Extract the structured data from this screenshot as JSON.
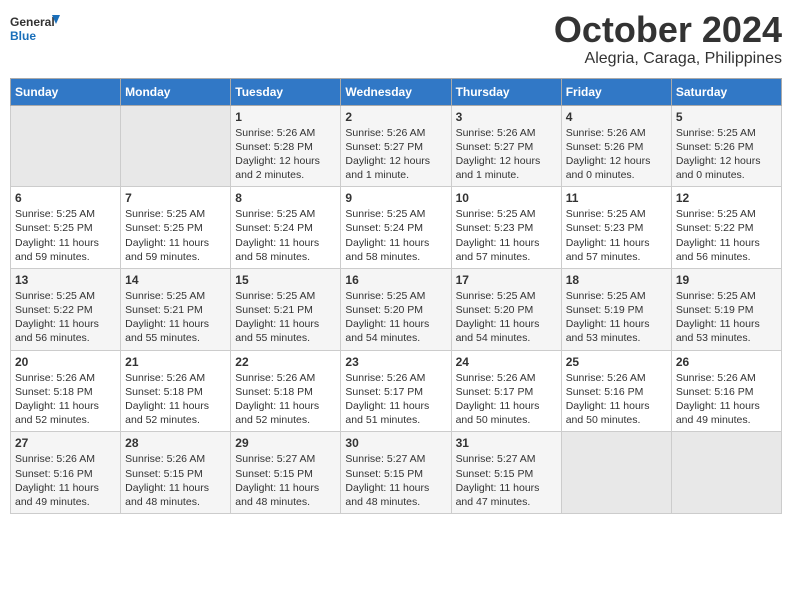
{
  "logo": {
    "text_general": "General",
    "text_blue": "Blue"
  },
  "title": "October 2024",
  "subtitle": "Alegria, Caraga, Philippines",
  "days_of_week": [
    "Sunday",
    "Monday",
    "Tuesday",
    "Wednesday",
    "Thursday",
    "Friday",
    "Saturday"
  ],
  "weeks": [
    [
      {
        "day": "",
        "content": ""
      },
      {
        "day": "",
        "content": ""
      },
      {
        "day": "1",
        "content": "Sunrise: 5:26 AM\nSunset: 5:28 PM\nDaylight: 12 hours\nand 2 minutes."
      },
      {
        "day": "2",
        "content": "Sunrise: 5:26 AM\nSunset: 5:27 PM\nDaylight: 12 hours\nand 1 minute."
      },
      {
        "day": "3",
        "content": "Sunrise: 5:26 AM\nSunset: 5:27 PM\nDaylight: 12 hours\nand 1 minute."
      },
      {
        "day": "4",
        "content": "Sunrise: 5:26 AM\nSunset: 5:26 PM\nDaylight: 12 hours\nand 0 minutes."
      },
      {
        "day": "5",
        "content": "Sunrise: 5:25 AM\nSunset: 5:26 PM\nDaylight: 12 hours\nand 0 minutes."
      }
    ],
    [
      {
        "day": "6",
        "content": "Sunrise: 5:25 AM\nSunset: 5:25 PM\nDaylight: 11 hours\nand 59 minutes."
      },
      {
        "day": "7",
        "content": "Sunrise: 5:25 AM\nSunset: 5:25 PM\nDaylight: 11 hours\nand 59 minutes."
      },
      {
        "day": "8",
        "content": "Sunrise: 5:25 AM\nSunset: 5:24 PM\nDaylight: 11 hours\nand 58 minutes."
      },
      {
        "day": "9",
        "content": "Sunrise: 5:25 AM\nSunset: 5:24 PM\nDaylight: 11 hours\nand 58 minutes."
      },
      {
        "day": "10",
        "content": "Sunrise: 5:25 AM\nSunset: 5:23 PM\nDaylight: 11 hours\nand 57 minutes."
      },
      {
        "day": "11",
        "content": "Sunrise: 5:25 AM\nSunset: 5:23 PM\nDaylight: 11 hours\nand 57 minutes."
      },
      {
        "day": "12",
        "content": "Sunrise: 5:25 AM\nSunset: 5:22 PM\nDaylight: 11 hours\nand 56 minutes."
      }
    ],
    [
      {
        "day": "13",
        "content": "Sunrise: 5:25 AM\nSunset: 5:22 PM\nDaylight: 11 hours\nand 56 minutes."
      },
      {
        "day": "14",
        "content": "Sunrise: 5:25 AM\nSunset: 5:21 PM\nDaylight: 11 hours\nand 55 minutes."
      },
      {
        "day": "15",
        "content": "Sunrise: 5:25 AM\nSunset: 5:21 PM\nDaylight: 11 hours\nand 55 minutes."
      },
      {
        "day": "16",
        "content": "Sunrise: 5:25 AM\nSunset: 5:20 PM\nDaylight: 11 hours\nand 54 minutes."
      },
      {
        "day": "17",
        "content": "Sunrise: 5:25 AM\nSunset: 5:20 PM\nDaylight: 11 hours\nand 54 minutes."
      },
      {
        "day": "18",
        "content": "Sunrise: 5:25 AM\nSunset: 5:19 PM\nDaylight: 11 hours\nand 53 minutes."
      },
      {
        "day": "19",
        "content": "Sunrise: 5:25 AM\nSunset: 5:19 PM\nDaylight: 11 hours\nand 53 minutes."
      }
    ],
    [
      {
        "day": "20",
        "content": "Sunrise: 5:26 AM\nSunset: 5:18 PM\nDaylight: 11 hours\nand 52 minutes."
      },
      {
        "day": "21",
        "content": "Sunrise: 5:26 AM\nSunset: 5:18 PM\nDaylight: 11 hours\nand 52 minutes."
      },
      {
        "day": "22",
        "content": "Sunrise: 5:26 AM\nSunset: 5:18 PM\nDaylight: 11 hours\nand 52 minutes."
      },
      {
        "day": "23",
        "content": "Sunrise: 5:26 AM\nSunset: 5:17 PM\nDaylight: 11 hours\nand 51 minutes."
      },
      {
        "day": "24",
        "content": "Sunrise: 5:26 AM\nSunset: 5:17 PM\nDaylight: 11 hours\nand 50 minutes."
      },
      {
        "day": "25",
        "content": "Sunrise: 5:26 AM\nSunset: 5:16 PM\nDaylight: 11 hours\nand 50 minutes."
      },
      {
        "day": "26",
        "content": "Sunrise: 5:26 AM\nSunset: 5:16 PM\nDaylight: 11 hours\nand 49 minutes."
      }
    ],
    [
      {
        "day": "27",
        "content": "Sunrise: 5:26 AM\nSunset: 5:16 PM\nDaylight: 11 hours\nand 49 minutes."
      },
      {
        "day": "28",
        "content": "Sunrise: 5:26 AM\nSunset: 5:15 PM\nDaylight: 11 hours\nand 48 minutes."
      },
      {
        "day": "29",
        "content": "Sunrise: 5:27 AM\nSunset: 5:15 PM\nDaylight: 11 hours\nand 48 minutes."
      },
      {
        "day": "30",
        "content": "Sunrise: 5:27 AM\nSunset: 5:15 PM\nDaylight: 11 hours\nand 48 minutes."
      },
      {
        "day": "31",
        "content": "Sunrise: 5:27 AM\nSunset: 5:15 PM\nDaylight: 11 hours\nand 47 minutes."
      },
      {
        "day": "",
        "content": ""
      },
      {
        "day": "",
        "content": ""
      }
    ]
  ]
}
